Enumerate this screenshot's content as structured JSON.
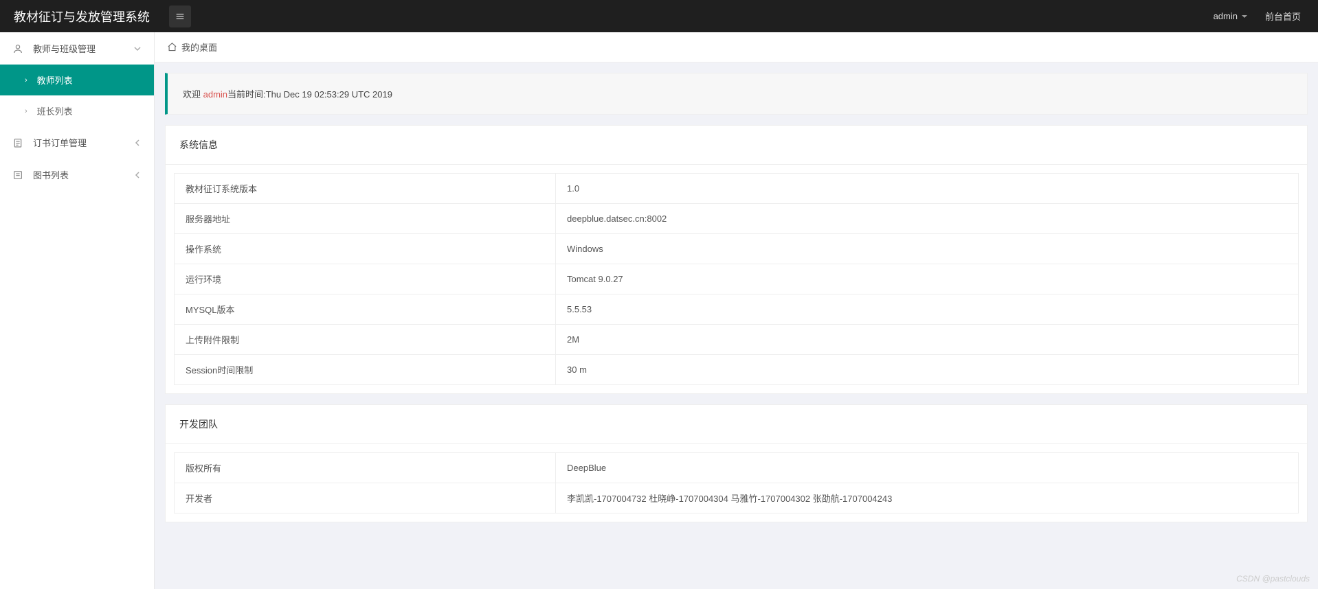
{
  "header": {
    "brand": "教材征订与发放管理系统",
    "user": "admin",
    "front_link": "前台首页"
  },
  "sidebar": {
    "sections": [
      {
        "label": "教师与班级管理",
        "expanded": true,
        "children": [
          {
            "label": "教师列表",
            "active": true
          },
          {
            "label": "班长列表",
            "active": false
          }
        ]
      },
      {
        "label": "订书订单管理",
        "expanded": false
      },
      {
        "label": "图书列表",
        "expanded": false
      }
    ]
  },
  "breadcrumb": {
    "label": "我的桌面"
  },
  "welcome": {
    "prefix": "欢迎 ",
    "user": "admin",
    "suffix": "当前时间:Thu Dec 19 02:53:29 UTC 2019"
  },
  "system_info": {
    "title": "系统信息",
    "rows": [
      {
        "k": "教材征订系统版本",
        "v": "1.0"
      },
      {
        "k": "服务器地址",
        "v": "deepblue.datsec.cn:8002"
      },
      {
        "k": "操作系统",
        "v": "Windows"
      },
      {
        "k": "运行环境",
        "v": "Tomcat 9.0.27"
      },
      {
        "k": "MYSQL版本",
        "v": "5.5.53"
      },
      {
        "k": "上传附件限制",
        "v": "2M"
      },
      {
        "k": "Session时间限制",
        "v": "30 m"
      }
    ]
  },
  "dev_team": {
    "title": "开发团队",
    "rows": [
      {
        "k": "版权所有",
        "v": "DeepBlue"
      },
      {
        "k": "开发者",
        "v": "李凯凯-1707004732 杜晓峥-1707004304 马雅竹-1707004302 张劭航-1707004243"
      }
    ]
  },
  "watermark": "CSDN @pastclouds"
}
